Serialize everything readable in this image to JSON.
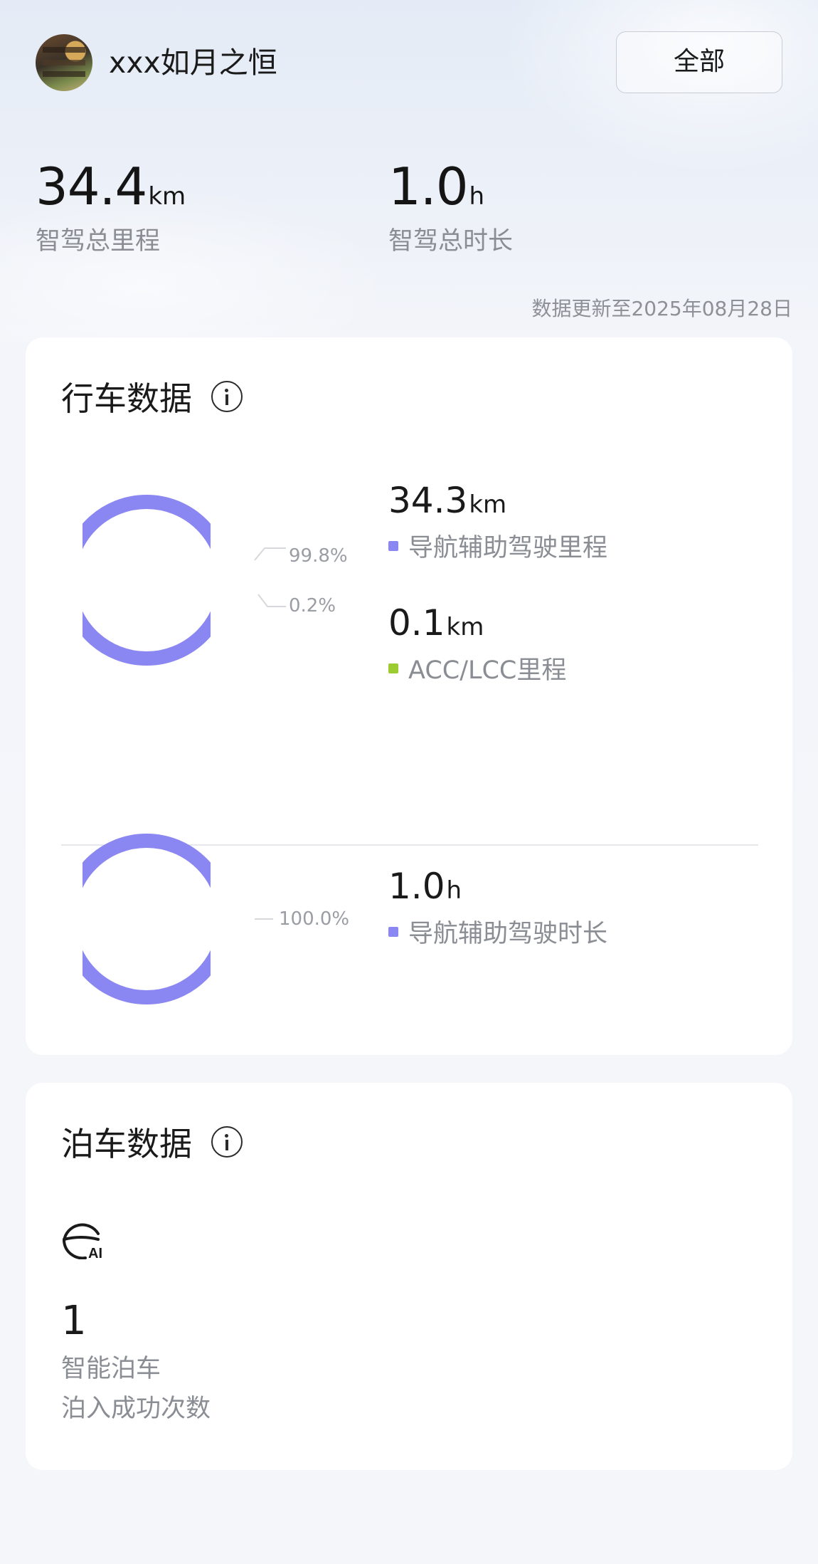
{
  "header": {
    "username": "xxx如月之恒",
    "filter_label": "全部"
  },
  "summary": {
    "distance": {
      "value": "34.4",
      "unit": "km",
      "label": "智驾总里程"
    },
    "duration": {
      "value": "1.0",
      "unit": "h",
      "label": "智驾总时长"
    },
    "update_note": "数据更新至2025年08月28日"
  },
  "driving": {
    "title": "行车数据",
    "mileage": {
      "items": [
        {
          "value": "34.3",
          "unit": "km",
          "label": "导航辅助驾驶里程",
          "percent": "99.8%",
          "share": 0.998,
          "color": "#8b87f2"
        },
        {
          "value": "0.1",
          "unit": "km",
          "label": "ACC/LCC里程",
          "percent": "0.2%",
          "share": 0.002,
          "color": "#9ccc32"
        }
      ]
    },
    "duration": {
      "items": [
        {
          "value": "1.0",
          "unit": "h",
          "label": "导航辅助驾驶时长",
          "percent": "100.0%",
          "share": 1.0,
          "color": "#8b87f2"
        }
      ]
    }
  },
  "parking": {
    "title": "泊车数据",
    "icon": "ai-parking-icon",
    "count": "1",
    "label_line1": "智能泊车",
    "label_line2": "泊入成功次数"
  }
}
